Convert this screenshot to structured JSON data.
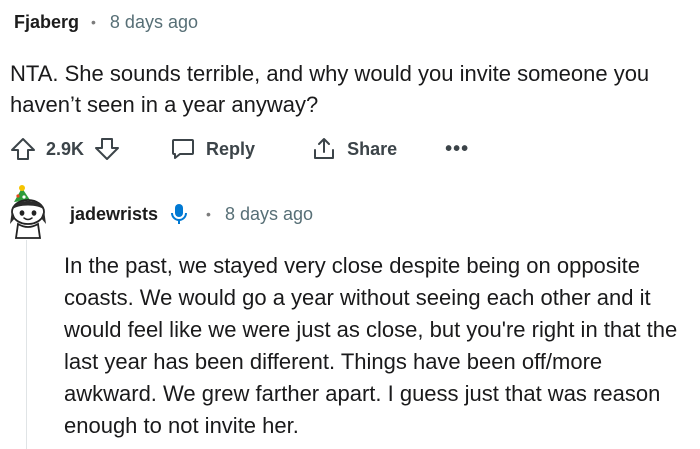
{
  "comment": {
    "author": "Fjaberg",
    "separator": "•",
    "time": "8 days ago",
    "text": "NTA. She sounds terrible, and why would you invite someone you haven’t seen in a year anyway?",
    "vote_count": "2.9K",
    "reply_label": "Reply",
    "share_label": "Share",
    "more_label": "•••"
  },
  "reply": {
    "author": "jadewrists",
    "separator": "•",
    "time": "8 days ago",
    "text": "In the past, we stayed very close despite being on opposite coasts. We would go a year without seeing each other and it would feel like we were just as close, but you're right in that the last year has been different. Things have been off/more awkward. We grew farther apart. I guess just that was reason enough to not invite her.",
    "badge_icon": "microphone-icon"
  },
  "icons": {
    "upvote": "upvote-arrow-icon",
    "downvote": "downvote-arrow-icon",
    "reply": "speech-bubble-icon",
    "share": "share-icon",
    "avatar": "snoo-avatar-icon"
  },
  "colors": {
    "text": "#1a1a1b",
    "meta": "#576f76",
    "action": "#3c4449",
    "badge_blue": "#0079d3"
  }
}
